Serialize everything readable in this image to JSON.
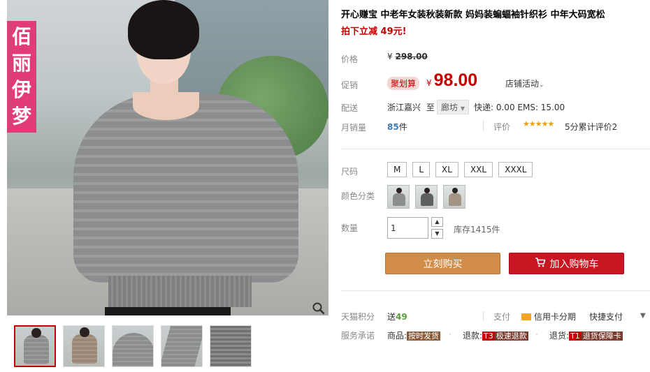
{
  "brand": {
    "vertical_text": [
      "佰",
      "丽",
      "伊",
      "梦"
    ]
  },
  "gallery": {
    "zoom_icon": "magnifier-icon",
    "thumbnails": [
      "full-body-gray",
      "full-body-tan",
      "closeup-neckline",
      "sleeve-detail",
      "fabric-detail"
    ]
  },
  "product": {
    "title": "开心赚宝 中老年女装秋装新款 妈妈装蝙蝠袖针织衫 中年大码宽松",
    "subtitle": "拍下立减 49元!"
  },
  "price": {
    "label": "价格",
    "currency": "¥",
    "original": "298.00"
  },
  "promo": {
    "label": "促销",
    "badge": "聚划算",
    "currency": "¥",
    "price": "98.00",
    "shop_activity": "店铺活动"
  },
  "shipping": {
    "label": "配送",
    "from": "浙江嘉兴",
    "to_label": "至",
    "to": "廊坊",
    "fee": "快递: 0.00 EMS: 15.00"
  },
  "sales": {
    "label": "月销量",
    "count": "85",
    "unit": "件",
    "review_label": "评价",
    "stars": "★★★★★",
    "review_text": "5分累计评价2"
  },
  "size": {
    "label": "尺码",
    "options": [
      "M",
      "L",
      "XL",
      "XXL",
      "XXXL"
    ]
  },
  "color": {
    "label": "颜色分类",
    "options": [
      "color-option-1",
      "color-option-2",
      "color-option-3"
    ]
  },
  "quantity": {
    "label": "数量",
    "value": "1",
    "up": "▲",
    "down": "▼",
    "stock": "库存1415件"
  },
  "actions": {
    "buy_now": "立刻购买",
    "add_cart": "加入购物车"
  },
  "points": {
    "label": "天猫积分",
    "prefix": "送",
    "value": "49"
  },
  "payment": {
    "label": "支付",
    "card": "信用卡分期",
    "quick": "快捷支付",
    "more": "▼"
  },
  "service": {
    "label": "服务承诺",
    "items": [
      {
        "prefix": "商品:",
        "tag": "按时发货"
      },
      {
        "prefix": "退款:",
        "tag_code": "T3",
        "tag": "极速退款"
      },
      {
        "prefix": "退货:",
        "tag_code": "T1",
        "tag": "退货保障卡"
      }
    ]
  },
  "colors": {
    "accent_red": "#c40000",
    "buy_orange": "#d18c47",
    "cart_red": "#c91623",
    "brand_pink": "#e23c78"
  }
}
